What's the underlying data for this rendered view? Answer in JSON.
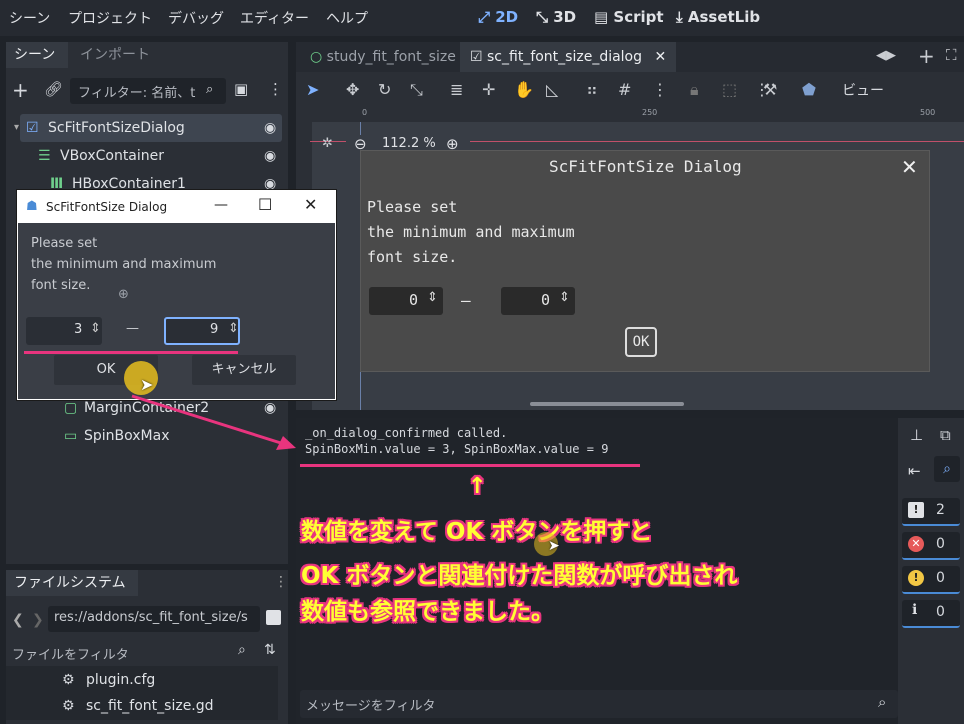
{
  "menu": {
    "items": [
      "シーン",
      "プロジェクト",
      "デバッグ",
      "エディター",
      "ヘルプ"
    ],
    "modes": [
      "2D",
      "3D",
      "Script",
      "AssetLib"
    ],
    "active_mode": "2D"
  },
  "scene_dock": {
    "tabs": [
      "シーン",
      "インポート"
    ],
    "filter_placeholder": "フィルター: 名前、t",
    "tree": [
      {
        "label": "ScFitFontSizeDialog",
        "selected": true
      },
      {
        "label": "VBoxContainer"
      },
      {
        "label": "HBoxContainer1"
      },
      {
        "label": "MarginContainer2"
      },
      {
        "label": "SpinBoxMax"
      }
    ]
  },
  "filesystem_dock": {
    "title": "ファイルシステム",
    "path": "res://addons/sc_fit_font_size/s",
    "filter_placeholder": "ファイルをフィルタ",
    "files": [
      "plugin.cfg",
      "sc_fit_font_size.gd"
    ]
  },
  "editor": {
    "tabs": [
      "study_fit_font_size",
      "sc_fit_font_size_dialog"
    ],
    "active_tab": "sc_fit_font_size_dialog",
    "view_label": "ビュー",
    "zoom": "112.2 %",
    "ruler_marks": [
      "0",
      "250",
      "500"
    ]
  },
  "game_dialog": {
    "title": "ScFitFontSize Dialog",
    "close": "✕",
    "message_lines": [
      "Please set",
      "the minimum and maximum",
      "font size."
    ],
    "min_value": "0",
    "max_value": "0",
    "separator": "—",
    "ok_label": "OK"
  },
  "float_window": {
    "title": "ScFitFontSize Dialog",
    "message_lines": [
      "Please set",
      "the minimum and maximum",
      "font size."
    ],
    "min_value": "3",
    "max_value": "9",
    "separator": "—",
    "ok_label": "OK",
    "cancel_label": "キャンセル"
  },
  "output": {
    "lines": [
      "_on_dialog_confirmed called.",
      "SpinBoxMin.value = 3, SpinBoxMax.value = 9"
    ],
    "filter_placeholder": "メッセージをフィルタ",
    "counts": {
      "messages": "2",
      "errors": "0",
      "warnings": "0",
      "info": "0"
    }
  },
  "annotation": {
    "arrow_up": "↑",
    "lines": [
      "数値を変えて OK ボタンを押すと",
      "OK ボタンと関連付けた関数が呼び出され",
      "数値も参照できました。"
    ]
  },
  "colors": {
    "accent": "#7fb2ff",
    "annotation_text": "#ffff33",
    "annotation_outline": "#e8347e"
  }
}
